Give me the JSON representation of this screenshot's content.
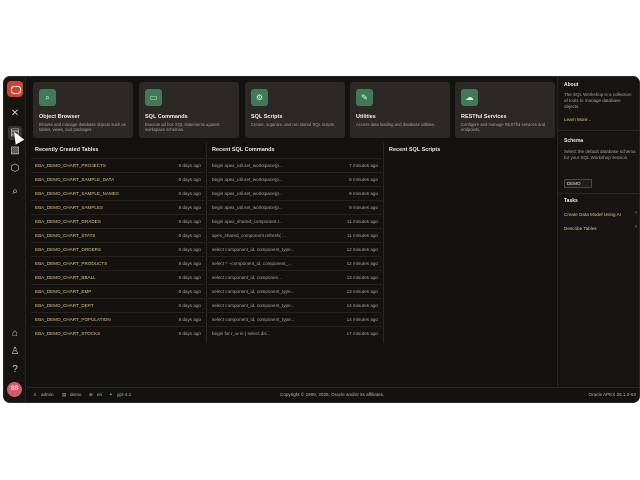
{
  "rail": {
    "icons": [
      "oracle-logo-icon",
      "tools-icon",
      "sql-workshop-icon",
      "data-icon",
      "package-icon",
      "search-icon",
      "home-icon",
      "user-settings-icon",
      "avatar"
    ],
    "avatar_initials": "SS"
  },
  "cards": [
    {
      "title": "Object Browser",
      "desc": "Browse and manage database objects such as tables, views, and packages.",
      "icon": "search-icon",
      "glyph": "⌕"
    },
    {
      "title": "SQL Commands",
      "desc": "Execute ad hoc SQL statements against workspace schemas.",
      "icon": "terminal-icon",
      "glyph": "▭"
    },
    {
      "title": "SQL Scripts",
      "desc": "Create, organize, and run stored SQL scripts.",
      "icon": "scripts-icon",
      "glyph": "⚙"
    },
    {
      "title": "Utilities",
      "desc": "Access data loading and database utilities.",
      "icon": "wrench-icon",
      "glyph": "✎"
    },
    {
      "title": "RESTful Services",
      "desc": "Configure and manage RESTful services and endpoints.",
      "icon": "cloud-upload-icon",
      "glyph": "☁"
    }
  ],
  "recent_tables": {
    "title": "Recently Created Tables",
    "rows": [
      {
        "name": "EBA_DEMO_CHART_PROJECTS",
        "time": "8 days ago"
      },
      {
        "name": "EBA_DEMO_CHART_SAMPLE_DATA",
        "time": "8 days ago"
      },
      {
        "name": "EBA_DEMO_CHART_SAMPLE_NAMES",
        "time": "8 days ago"
      },
      {
        "name": "EBA_DEMO_CHART_SAMPLES",
        "time": "8 days ago"
      },
      {
        "name": "EBA_DEMO_CHART_GRADES",
        "time": "8 days ago"
      },
      {
        "name": "EBA_DEMO_CHART_STATS",
        "time": "8 days ago"
      },
      {
        "name": "EBA_DEMO_CHART_ORDERS",
        "time": "8 days ago"
      },
      {
        "name": "EBA_DEMO_CHART_PRODUCTS",
        "time": "8 days ago"
      },
      {
        "name": "EBA_DEMO_CHART_BBALL",
        "time": "8 days ago"
      },
      {
        "name": "EBA_DEMO_CHART_EMP",
        "time": "8 days ago"
      },
      {
        "name": "EBA_DEMO_CHART_DEPT",
        "time": "8 days ago"
      },
      {
        "name": "EBA_DEMO_CHART_POPULATION",
        "time": "8 days ago"
      },
      {
        "name": "EBA_DEMO_CHART_STOCKS",
        "time": "8 days ago"
      }
    ]
  },
  "recent_sql": {
    "title": "Recent SQL Commands",
    "rows": [
      {
        "cmd": "begin apex_util.set_workspace(p...",
        "time": "7 minutes ago"
      },
      {
        "cmd": "begin apex_util.set_workspace(p...",
        "time": "8 minutes ago"
      },
      {
        "cmd": "begin apex_util.set_workspace(p...",
        "time": "9 minutes ago"
      },
      {
        "cmd": "begin apex_util.set_workspace(p...",
        "time": "9 minutes ago"
      },
      {
        "cmd": "begin apex_shared_component.r...",
        "time": "11 minutes ago"
      },
      {
        "cmd": "apex_shared_component.refresh( ...",
        "time": "11 minutes ago"
      },
      {
        "cmd": "select component_id, component_type...",
        "time": "12 minutes ago"
      },
      {
        "cmd": "select * --component_id, component_...",
        "time": "12 minutes ago"
      },
      {
        "cmd": "select component_id, componen...",
        "time": "13 minutes ago"
      },
      {
        "cmd": "select component_id, component_type...",
        "time": "13 minutes ago"
      },
      {
        "cmd": "select component_id, component_type...",
        "time": "14 minutes ago"
      },
      {
        "cmd": "select component_id, component_type...",
        "time": "14 minutes ago"
      },
      {
        "cmd": "begin for r_w in ( select dis...",
        "time": "17 minutes ago"
      }
    ]
  },
  "recent_scripts": {
    "title": "Recent SQL Scripts"
  },
  "side": {
    "about_title": "About",
    "about_text": "The SQL Workshop is a collection of tools to manage database objects.",
    "learn_more": "Learn More...",
    "schema_title": "Schema",
    "schema_text": "Select the default database schema for your SQL Workshop session.",
    "schema_value": "DEMO",
    "tasks_title": "Tasks",
    "task1": "Create Data Model Using AI",
    "task2": "Describe Tables"
  },
  "footer": {
    "user": "admin",
    "workspace": "demo",
    "lang": "en",
    "model": "gpt-4.1",
    "copyright": "Copyright © 1999, 2026, Oracle and/or its affiliates.",
    "version": "Oracle APEX 26.1.0-63"
  }
}
